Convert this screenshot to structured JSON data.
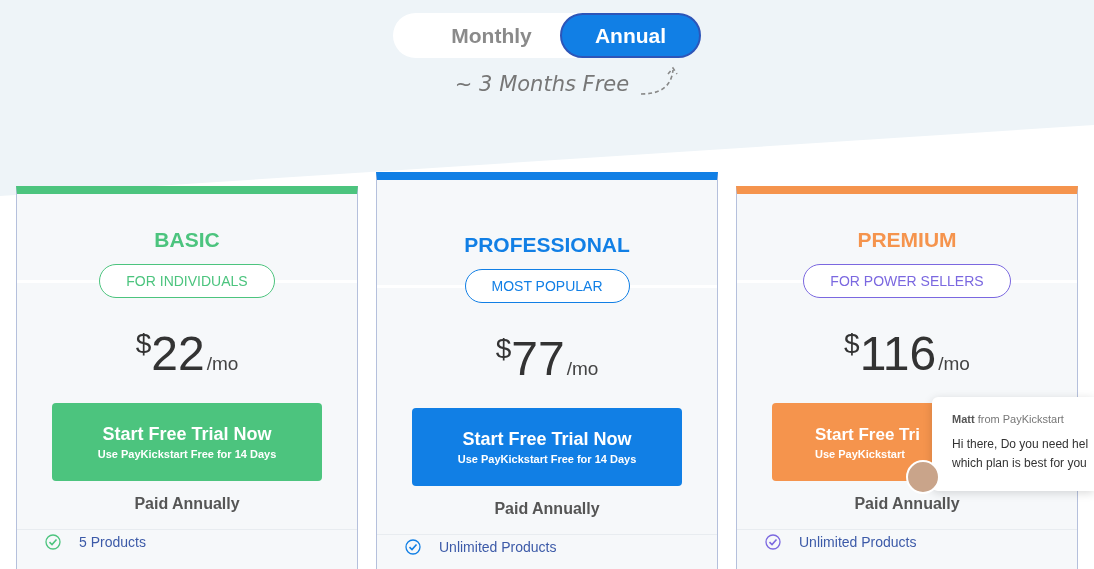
{
  "billing_toggle": [
    {
      "label": "Monthly",
      "selected": false
    },
    {
      "label": "Annual",
      "selected": true
    }
  ],
  "promo_note": "~ 3 Months Free",
  "plans": [
    {
      "name": "BASIC",
      "color": "#4cc47e",
      "tag": {
        "label": "FOR INDIVIDUALS",
        "color": "#4cc47e"
      },
      "featured": false,
      "currency": "$",
      "price": "22",
      "period": "/mo",
      "cta": {
        "title": "Start Free Trial Now",
        "subtitle": "Use PayKickstart Free for 14 Days"
      },
      "billing": "Paid Annually",
      "features": [
        {
          "label": "5 Products"
        }
      ]
    },
    {
      "name": "PROFESSIONAL",
      "color": "#117fe5",
      "tag": {
        "label": "MOST POPULAR",
        "color": "#117fe5"
      },
      "featured": true,
      "currency": "$",
      "price": "77",
      "period": "/mo",
      "cta": {
        "title": "Start Free Trial Now",
        "subtitle": "Use PayKickstart Free for 14 Days"
      },
      "billing": "Paid Annually",
      "features": [
        {
          "label": "Unlimited Products"
        }
      ]
    },
    {
      "name": "PREMIUM",
      "color": "#f5944d",
      "tag": {
        "label": "FOR POWER SELLERS",
        "color": "#7b68e0"
      },
      "featured": false,
      "currency": "$",
      "price": "116",
      "period": "/mo",
      "cta": {
        "title": "Start Free Tri",
        "subtitle": "Use PayKickstart",
        "cut_off": true
      },
      "billing": "Paid Annually",
      "features": [
        {
          "label": "Unlimited Products"
        }
      ]
    }
  ],
  "chat": {
    "sender": "Matt",
    "source": "from PayKickstart",
    "lines": [
      "Hi there, Do you need hel",
      "which plan is best for you"
    ]
  }
}
